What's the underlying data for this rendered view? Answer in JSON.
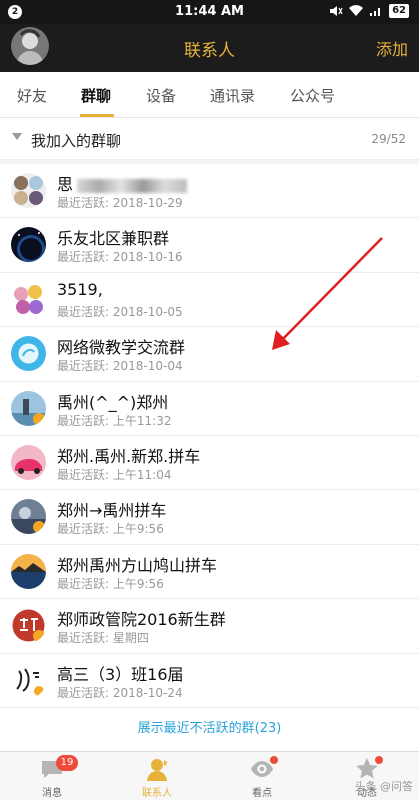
{
  "status_bar": {
    "notification_count": "2",
    "time": "11:44 AM",
    "battery": "62"
  },
  "header": {
    "title": "联系人",
    "add_label": "添加"
  },
  "tabs": [
    {
      "label": "好友",
      "active": false
    },
    {
      "label": "群聊",
      "active": true
    },
    {
      "label": "设备",
      "active": false
    },
    {
      "label": "通讯录",
      "active": false
    },
    {
      "label": "公众号",
      "active": false
    }
  ],
  "section": {
    "label": "我加入的群聊",
    "count": "29/52"
  },
  "groups": [
    {
      "name": "思",
      "subtitle_label": "最近活跃:",
      "last_active": "2018-10-29"
    },
    {
      "name": "乐友北区兼职群",
      "subtitle_label": "最近活跃:",
      "last_active": "2018-10-16"
    },
    {
      "name": "3519,",
      "subtitle_label": "最近活跃:",
      "last_active": "2018-10-05"
    },
    {
      "name": "网络微教学交流群",
      "subtitle_label": "最近活跃:",
      "last_active": "2018-10-04"
    },
    {
      "name": "禹州(^_^)郑州",
      "subtitle_label": "最近活跃:",
      "last_active": "上午11:32"
    },
    {
      "name": "郑州.禹州.新郑.拼车",
      "subtitle_label": "最近活跃:",
      "last_active": "上午11:04"
    },
    {
      "name": "郑州→禹州拼车",
      "subtitle_label": "最近活跃:",
      "last_active": "上午9:56"
    },
    {
      "name": "郑州禹州方山鸠山拼车",
      "subtitle_label": "最近活跃:",
      "last_active": "上午9:56"
    },
    {
      "name": "郑师政管院2016新生群",
      "subtitle_label": "最近活跃:",
      "last_active": "星期四"
    },
    {
      "name": "高三（3）班16届",
      "subtitle_label": "最近活跃:",
      "last_active": "2018-10-24"
    }
  ],
  "show_inactive_label": "展示最近不活跃的群(23)",
  "bottom_nav": {
    "items": [
      {
        "label": "消息",
        "badge": "19",
        "icon": "message-icon"
      },
      {
        "label": "联系人",
        "active": true,
        "icon": "contacts-icon"
      },
      {
        "label": "看点",
        "icon": "eye-icon"
      },
      {
        "label": "动态",
        "icon": "star-icon"
      }
    ],
    "watermark": "头条 @问答"
  },
  "colors": {
    "accent": "#e6b23a",
    "link": "#2aa3d9",
    "badge": "#f04a3a",
    "header_bg": "#1c1c1c",
    "arrow": "#e02020"
  }
}
